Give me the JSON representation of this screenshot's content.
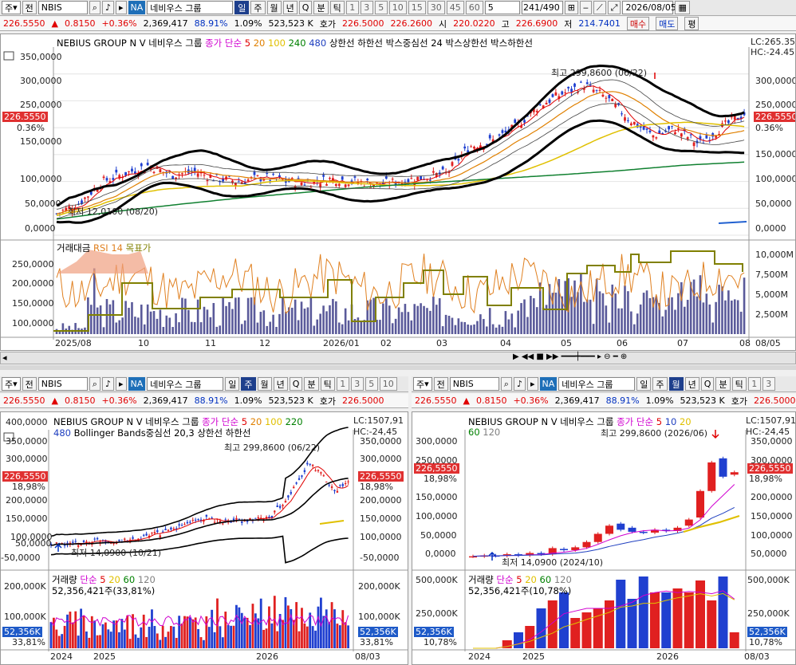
{
  "top": {
    "toolbar": {
      "period_sel": "주",
      "mode": "전",
      "code": "NBIS",
      "exchange_badge": "NA",
      "name": "네비우스 그룹",
      "tabs": [
        "일",
        "주",
        "월",
        "년",
        "Q",
        "분",
        "틱"
      ],
      "nums": [
        "1",
        "3",
        "5",
        "10",
        "15",
        "30",
        "45",
        "60",
        "5"
      ],
      "count": "241",
      "total": "/490",
      "date": "2026/08/05"
    },
    "quote": {
      "price": "226.5550",
      "arrow": "▲",
      "change": "0.8150",
      "pct": "+0.36%",
      "volume": "2,369,417",
      "rate": "88.91%",
      "turnover": "1.09%",
      "shares": "523,523 K",
      "ask_label": "호가",
      "ask": "226.5000",
      "bid": "226.2600",
      "open_label": "시",
      "open": "220.0220",
      "high_label": "고",
      "high": "226.6900",
      "low_label": "저",
      "low": "214.7401",
      "buy": "매수",
      "sell": "매도",
      "avg": "평"
    },
    "chart": {
      "title": "NEBIUS GROUP N V 네비우스 그룹",
      "legend": [
        "종가 단순",
        "5",
        "20",
        "100",
        "240",
        "480",
        "상한선",
        "하한선",
        "박스중심선",
        "24",
        "박스상한선",
        "박스하한선"
      ],
      "lc": "LC:265.35",
      "hc": "HC:-24.45",
      "price_tag": "226.5550",
      "pct_tag": "0.36%",
      "yaxis": [
        "350,0000",
        "300,0000",
        "250,0000",
        "200,0000",
        "150,0000",
        "100,0000",
        "50,0000",
        "0,0000"
      ],
      "yaxis_r": [
        "300,0000",
        "250,0000",
        "200,0000",
        "150,0000",
        "100,0000",
        "50,0000",
        "0,0000"
      ],
      "hi_label": "최고 299,8600 (06/22)",
      "lo_label": "최저 12,0100 (08/20)"
    },
    "lower": {
      "legend": [
        "거래대금",
        "RSI 14",
        "목표가"
      ],
      "yaxis": [
        "250,0000",
        "200,0000",
        "150,0000",
        "100,0000"
      ],
      "yaxis_r": [
        "10,000M",
        "7,500M",
        "5,000M",
        "2,500M"
      ],
      "xaxis": [
        "2025/08",
        "10",
        "11",
        "12",
        "2026/01",
        "02",
        "03",
        "04",
        "05",
        "06",
        "07",
        "08",
        "08/05"
      ]
    }
  },
  "left": {
    "toolbar": {
      "period_sel": "주",
      "mode": "전",
      "code": "NBIS",
      "exchange_badge": "NA",
      "name": "네비우스 그룹",
      "tabs": [
        "일",
        "주",
        "월",
        "년",
        "Q",
        "분",
        "틱"
      ],
      "nums": [
        "1",
        "3",
        "5",
        "10"
      ]
    },
    "quote": {
      "price": "226.5550",
      "change": "0.8150",
      "pct": "+0.36%",
      "volume": "2,369,417",
      "rate": "88.91%",
      "turnover": "1.09%",
      "shares": "523,523 K",
      "ask_label": "호가",
      "ask": "226.5000"
    },
    "chart": {
      "title": "NEBIUS GROUP N V 네비우스 그룹",
      "legend1": [
        "종가 단순",
        "5",
        "20",
        "100",
        "220"
      ],
      "legend2": [
        "480",
        "Bollinger Bands중심선 20,3",
        "상한선",
        "하한선"
      ],
      "lc": "LC:1507,91",
      "hc": "HC:-24,45",
      "price_tag": "226,5550",
      "pct_tag": "18,98%",
      "yaxis": [
        "400,0000",
        "350,0000",
        "300,0000",
        "250,0000",
        "200,0000",
        "150,0000",
        "100,0000",
        "50,0000",
        "0,0000",
        "-50,0000"
      ],
      "yaxis_r": [
        "350,0000",
        "300,0000",
        "250,0000",
        "200,0000",
        "150,0000",
        "100,0000",
        "50,0000",
        "0,0000",
        "-50,0000"
      ],
      "hi_label": "최고 299,8600 (06/22)",
      "lo_label": "최저 14,0900 (10/21)"
    },
    "vol": {
      "legend": [
        "거래량",
        "단순",
        "5",
        "20",
        "60",
        "120"
      ],
      "info": "52,356,421주(33,81%)",
      "yaxis": [
        "200,000K",
        "100,000K"
      ],
      "yaxis_r": [
        "200,000K",
        "100,000K"
      ],
      "vtag": "52,356K",
      "vpct": "33,81%",
      "xaxis": [
        "2024",
        "2025",
        "2026",
        "08/03"
      ]
    }
  },
  "right": {
    "toolbar": {
      "period_sel": "주",
      "mode": "전",
      "code": "NBIS",
      "exchange_badge": "NA",
      "name": "네비우스 그룹",
      "tabs": [
        "일",
        "주",
        "월",
        "년",
        "Q",
        "분",
        "틱"
      ],
      "nums": [
        "1",
        "3"
      ]
    },
    "quote": {
      "price": "226.5550",
      "change": "0.8150",
      "pct": "+0.36%",
      "volume": "2,369,417",
      "rate": "88.91%",
      "turnover": "1.09%",
      "shares": "523,523 K",
      "ask_label": "호가",
      "ask": "226.5000"
    },
    "chart": {
      "title": "NEBIUS GROUP N V 네비우스 그룹",
      "legend1": [
        "종가 단순",
        "5",
        "10",
        "20"
      ],
      "legend2": [
        "60",
        "120"
      ],
      "lc": "LC:1507,91",
      "hc": "HC:-24,45",
      "price_tag": "226,5550",
      "pct_tag": "18,98%",
      "yaxis": [
        "300,0000",
        "250,0000",
        "200,0000",
        "150,0000",
        "100,0000",
        "50,0000",
        "0,0000"
      ],
      "yaxis_r": [
        "350,0000",
        "300,0000",
        "250,0000",
        "200,0000",
        "150,0000",
        "100,0000",
        "50,0000",
        "0,0000"
      ],
      "hi_label": "최고 299,8600 (2026/06)",
      "lo_label": "최저 14,0900 (2024/10)"
    },
    "vol": {
      "legend": [
        "거래량",
        "단순",
        "5",
        "20",
        "60",
        "120"
      ],
      "info": "52,356,421주(10,78%)",
      "yaxis": [
        "500,000K",
        "250,000K"
      ],
      "yaxis_r": [
        "500,000K",
        "250,000K"
      ],
      "vtag": "52,356K",
      "vpct": "10,78%",
      "xaxis": [
        "2024",
        "2025",
        "2026",
        "08/03"
      ]
    }
  },
  "chart_data": [
    {
      "type": "line",
      "title": "NEBIUS GROUP N V 네비우스 그룹",
      "x": [
        "2025/08",
        "10",
        "11",
        "12",
        "2026/01",
        "02",
        "03",
        "04",
        "05",
        "06",
        "07",
        "08"
      ],
      "series": [
        {
          "name": "종가",
          "values": [
            40,
            115,
            120,
            105,
            102,
            98,
            100,
            105,
            170,
            240,
            200,
            226.55
          ]
        }
      ],
      "ylim": [
        0,
        350
      ]
    },
    {
      "type": "bar",
      "title": "NEBIUS GROUP N V 네비우스 그룹",
      "categories": [
        "2024",
        "2025",
        "2026"
      ],
      "series": [
        {
          "name": "거래량",
          "values": [
            120,
            200,
            300
          ]
        }
      ],
      "ylim": [
        0,
        500
      ]
    }
  ]
}
